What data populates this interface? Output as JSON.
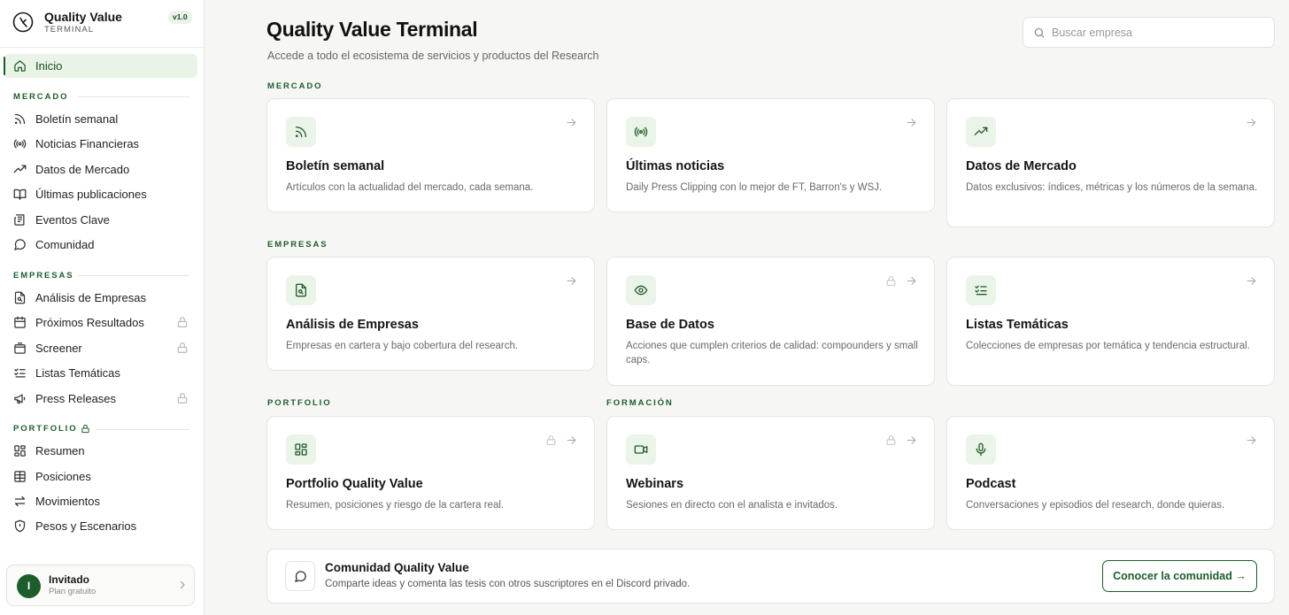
{
  "brand": {
    "name": "Quality Value",
    "subtitle": "TERMINAL",
    "version": "v1.0",
    "logo_icon": "quality-value-logo-icon"
  },
  "sidebar": {
    "active_item": {
      "label": "Inicio",
      "icon": "home-icon"
    },
    "sections": [
      {
        "title": "MERCADO",
        "items": [
          {
            "label": "Boletín semanal",
            "icon": "rss-icon",
            "locked": false
          },
          {
            "label": "Noticias Financieras",
            "icon": "broadcast-icon",
            "locked": false
          },
          {
            "label": "Datos de Mercado",
            "icon": "trending-up-icon",
            "locked": false
          },
          {
            "label": "Últimas publicaciones",
            "icon": "book-icon",
            "locked": false
          },
          {
            "label": "Eventos Clave",
            "icon": "newspaper-icon",
            "locked": false
          },
          {
            "label": "Comunidad",
            "icon": "message-circle-icon",
            "locked": false
          }
        ]
      },
      {
        "title": "EMPRESAS",
        "items": [
          {
            "label": "Análisis de Empresas",
            "icon": "file-search-icon",
            "locked": false
          },
          {
            "label": "Próximos Resultados",
            "icon": "calendar-icon",
            "locked": true
          },
          {
            "label": "Screener",
            "icon": "box-icon",
            "locked": true
          },
          {
            "label": "Listas Temáticas",
            "icon": "list-checks-icon",
            "locked": false
          },
          {
            "label": "Press Releases",
            "icon": "megaphone-icon",
            "locked": true
          }
        ]
      },
      {
        "title": "PORTFOLIO",
        "locked": true,
        "items": [
          {
            "label": "Resumen",
            "icon": "layout-grid-icon",
            "locked": false
          },
          {
            "label": "Posiciones",
            "icon": "table-icon",
            "locked": false
          },
          {
            "label": "Movimientos",
            "icon": "arrows-swap-icon",
            "locked": false
          },
          {
            "label": "Pesos y Escenarios",
            "icon": "shield-icon",
            "locked": false
          }
        ]
      }
    ]
  },
  "user": {
    "initial": "I",
    "name": "Invitado",
    "plan": "Plan gratuito"
  },
  "main": {
    "title": "Quality Value Terminal",
    "subtitle": "Accede a todo el ecosistema de servicios y productos del Research",
    "search": {
      "placeholder": "Buscar empresa",
      "value": ""
    },
    "groups": {
      "mercado": "MERCADO",
      "empresas": "EMPRESAS",
      "portfolio": "PORTFOLIO",
      "formacion": "FORMACIÓN"
    },
    "cards": [
      {
        "title": "Boletín semanal",
        "description": "Artículos con la actualidad del mercado, cada semana.",
        "icon": "rss-icon",
        "locked": false
      },
      {
        "title": "Últimas noticias",
        "description": "Daily Press Clipping con lo mejor de FT, Barron's y WSJ.",
        "icon": "broadcast-icon",
        "locked": false
      },
      {
        "title": "Datos de Mercado",
        "description": "Datos exclusivos: índices, métricas y los números de la semana.",
        "icon": "trending-up-icon",
        "locked": false
      },
      {
        "title": "Análisis de Empresas",
        "description": "Empresas en cartera y bajo cobertura del research.",
        "icon": "file-search-icon",
        "locked": false
      },
      {
        "title": "Base de Datos",
        "description": "Acciones que cumplen criterios de calidad: compounders y small caps.",
        "icon": "eye-icon",
        "locked": true
      },
      {
        "title": "Listas Temáticas",
        "description": "Colecciones de empresas por temática y tendencia estructural.",
        "icon": "list-checks-icon",
        "locked": false
      },
      {
        "title": "Portfolio Quality Value",
        "description": "Resumen, posiciones y riesgo de la cartera real.",
        "icon": "layout-grid-icon",
        "locked": true
      },
      {
        "title": "Webinars",
        "description": "Sesiones en directo con el analista e invitados.",
        "icon": "video-icon",
        "locked": true
      },
      {
        "title": "Podcast",
        "description": "Conversaciones y episodios del research, donde quieras.",
        "icon": "mic-icon",
        "locked": false
      }
    ],
    "community": {
      "title": "Comunidad Quality Value",
      "description": "Comparte ideas y comenta las tesis con otros suscriptores en el Discord privado.",
      "button": "Conocer la comunidad →",
      "icon": "message-circle-icon"
    }
  },
  "colors": {
    "accent": "#1d5c2b",
    "accent_soft": "#ebf4e9",
    "background": "#f6f6f5",
    "lock": "#b8b8b8"
  }
}
